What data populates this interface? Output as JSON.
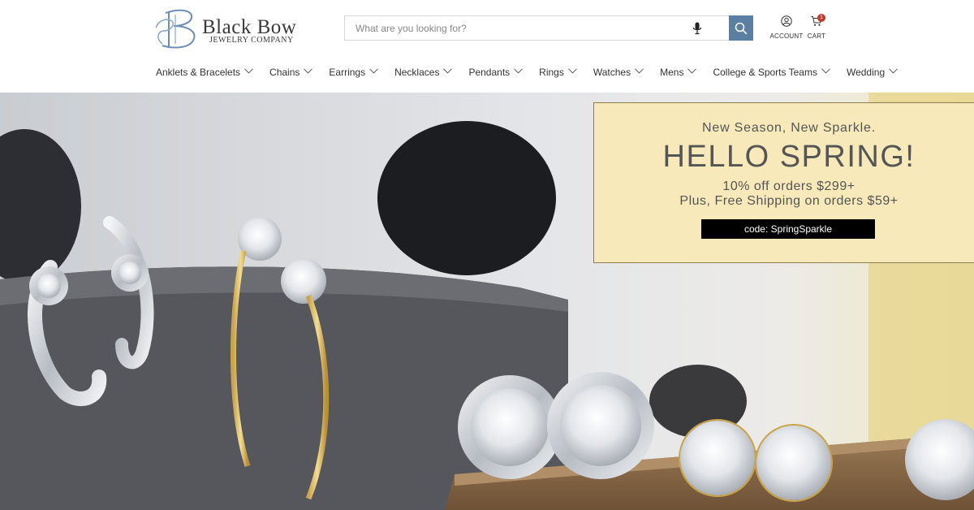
{
  "brand": {
    "name": "Black Bow",
    "subtitle": "JEWELRY COMPANY"
  },
  "search": {
    "placeholder": "What are you looking for?",
    "value": ""
  },
  "utility": {
    "account_label": "ACCOUNT",
    "cart_label": "CART",
    "cart_count": "1"
  },
  "nav": {
    "items": [
      {
        "label": "Anklets & Bracelets"
      },
      {
        "label": "Chains"
      },
      {
        "label": "Earrings"
      },
      {
        "label": "Necklaces"
      },
      {
        "label": "Pendants"
      },
      {
        "label": "Rings"
      },
      {
        "label": "Watches"
      },
      {
        "label": "Mens"
      },
      {
        "label": "College & Sports Teams"
      },
      {
        "label": "Wedding"
      }
    ]
  },
  "promo": {
    "tagline": "New Season, New Sparkle.",
    "headline": "HELLO SPRING!",
    "offer_line1": "10% off orders $299+",
    "offer_line2": "Plus, Free Shipping on orders $59+",
    "code": "code: SpringSparkle"
  },
  "colors": {
    "search_button": "#5b7ea3",
    "promo_background": "#f7e9b9",
    "cart_badge": "#c0392b",
    "code_background": "#000000"
  },
  "icons": [
    "logo-monogram-icon",
    "microphone-icon",
    "search-icon",
    "account-icon",
    "cart-icon",
    "chevron-down-icon"
  ]
}
